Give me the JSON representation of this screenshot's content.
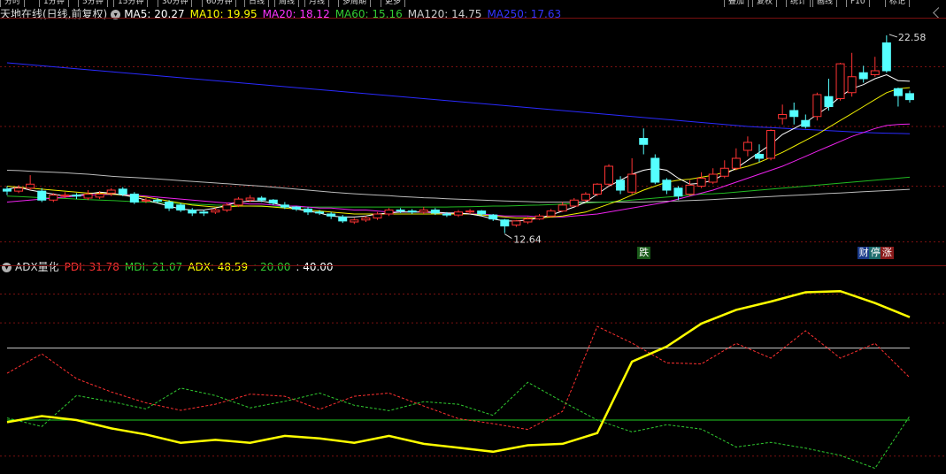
{
  "period_buttons": [
    "分时",
    "1分钟",
    "5分钟",
    "15分钟",
    "30分钟",
    "60分钟",
    "日线",
    "周线",
    "月线",
    "多周期",
    "更多"
  ],
  "right_buttons": [
    "叠加",
    "复权",
    "统计",
    "画线",
    "F10",
    "标记"
  ],
  "main_panel": {
    "title": "天地在线(日线,前复权)",
    "ma_labels": [
      {
        "text": "MA5: 20.27",
        "color": "#ffffff"
      },
      {
        "text": "MA10: 19.95",
        "color": "#ffff00"
      },
      {
        "text": "MA20: 18.12",
        "color": "#ff33ff"
      },
      {
        "text": "MA60: 15.16",
        "color": "#33cc33"
      },
      {
        "text": "MA120: 14.75",
        "color": "#cccccc"
      },
      {
        "text": "MA250: 17.63",
        "color": "#3333ff"
      }
    ],
    "high_label": "22.58",
    "low_label": "12.64",
    "marks": [
      "跌",
      "财",
      "停",
      "涨"
    ]
  },
  "indicator_panel": {
    "name": "ADX量化",
    "labels": [
      {
        "text": "PDI: 31.78",
        "color": "#ff3333"
      },
      {
        "text": "MDI: 21.07",
        "color": "#33cc33"
      },
      {
        "text": "ADX: 48.59",
        "color": "#ffff00"
      },
      {
        "text": ": 20.00",
        "color": "#33cc33"
      },
      {
        "text": ": 40.00",
        "color": "#ffffff"
      }
    ]
  },
  "chart_data": {
    "type": "candlestick",
    "candles": [
      [
        14.85,
        14.75,
        15.0,
        14.55
      ],
      [
        14.75,
        14.9,
        15.05,
        14.65
      ],
      [
        14.9,
        15.1,
        15.55,
        14.8
      ],
      [
        14.75,
        14.3,
        14.9,
        14.2
      ],
      [
        14.3,
        14.55,
        14.65,
        14.2
      ],
      [
        14.5,
        14.55,
        14.7,
        14.4
      ],
      [
        14.55,
        14.5,
        14.65,
        14.35
      ],
      [
        14.4,
        14.6,
        14.8,
        14.3
      ],
      [
        14.45,
        14.6,
        14.75,
        14.35
      ],
      [
        14.65,
        14.8,
        14.9,
        14.5
      ],
      [
        14.85,
        14.6,
        14.95,
        14.5
      ],
      [
        14.6,
        14.2,
        14.7,
        14.1
      ],
      [
        14.25,
        14.3,
        14.4,
        14.15
      ],
      [
        14.3,
        14.25,
        14.4,
        14.15
      ],
      [
        14.2,
        13.9,
        14.3,
        13.75
      ],
      [
        14.05,
        13.8,
        14.15,
        13.7
      ],
      [
        13.8,
        13.65,
        13.9,
        13.5
      ],
      [
        13.7,
        13.65,
        13.8,
        13.5
      ],
      [
        13.7,
        13.8,
        13.9,
        13.6
      ],
      [
        13.8,
        14.05,
        14.15,
        13.7
      ],
      [
        14.05,
        14.35,
        14.45,
        13.95
      ],
      [
        14.3,
        14.4,
        14.55,
        14.2
      ],
      [
        14.4,
        14.3,
        14.5,
        14.2
      ],
      [
        14.3,
        14.15,
        14.35,
        14.05
      ],
      [
        14.05,
        13.95,
        14.2,
        13.85
      ],
      [
        13.95,
        13.85,
        14.0,
        13.75
      ],
      [
        13.85,
        13.7,
        13.95,
        13.55
      ],
      [
        13.7,
        13.65,
        13.8,
        13.55
      ],
      [
        13.6,
        13.5,
        13.7,
        13.35
      ],
      [
        13.45,
        13.25,
        13.55,
        13.15
      ],
      [
        13.2,
        13.3,
        13.4,
        13.1
      ],
      [
        13.3,
        13.4,
        13.5,
        13.2
      ],
      [
        13.4,
        13.6,
        13.7,
        13.3
      ],
      [
        13.6,
        13.8,
        13.9,
        13.5
      ],
      [
        13.8,
        13.75,
        13.9,
        13.65
      ],
      [
        13.75,
        13.7,
        13.85,
        13.6
      ],
      [
        13.7,
        13.8,
        13.95,
        13.6
      ],
      [
        13.8,
        13.65,
        13.9,
        13.55
      ],
      [
        13.6,
        13.55,
        13.7,
        13.45
      ],
      [
        13.55,
        13.7,
        13.8,
        13.45
      ],
      [
        13.7,
        13.75,
        13.85,
        13.6
      ],
      [
        13.75,
        13.6,
        13.8,
        13.5
      ],
      [
        13.55,
        13.35,
        13.6,
        13.25
      ],
      [
        13.3,
        13.0,
        13.35,
        12.64
      ],
      [
        13.05,
        13.25,
        13.3,
        12.95
      ],
      [
        13.2,
        13.35,
        13.45,
        13.1
      ],
      [
        13.35,
        13.5,
        13.6,
        13.3
      ],
      [
        13.5,
        13.75,
        13.85,
        13.45
      ],
      [
        13.75,
        14.05,
        14.2,
        13.7
      ],
      [
        14.0,
        14.3,
        14.4,
        13.95
      ],
      [
        14.3,
        14.6,
        14.7,
        14.2
      ],
      [
        14.6,
        15.1,
        15.15,
        14.5
      ],
      [
        15.1,
        16.0,
        16.1,
        15.0
      ],
      [
        15.3,
        14.8,
        15.5,
        14.6
      ],
      [
        14.7,
        15.6,
        16.4,
        14.6
      ],
      [
        17.4,
        17.1,
        17.9,
        16.6
      ],
      [
        16.4,
        15.2,
        16.6,
        15.1
      ],
      [
        15.3,
        14.8,
        15.4,
        14.6
      ],
      [
        14.9,
        14.5,
        15.0,
        14.3
      ],
      [
        14.6,
        15.05,
        15.3,
        14.5
      ],
      [
        15.0,
        15.4,
        15.7,
        14.9
      ],
      [
        15.2,
        15.6,
        15.9,
        15.1
      ],
      [
        15.5,
        15.9,
        16.3,
        15.4
      ],
      [
        15.9,
        16.4,
        16.9,
        15.8
      ],
      [
        16.8,
        17.2,
        17.5,
        16.5
      ],
      [
        16.6,
        16.4,
        17.1,
        16.2
      ],
      [
        16.4,
        17.8,
        17.85,
        16.3
      ],
      [
        18.4,
        18.6,
        19.1,
        18.1
      ],
      [
        18.8,
        18.5,
        19.2,
        18.1
      ],
      [
        18.3,
        18.0,
        18.6,
        17.9
      ],
      [
        18.5,
        19.6,
        19.7,
        18.3
      ],
      [
        19.5,
        19.0,
        20.4,
        18.8
      ],
      [
        19.4,
        21.15,
        21.2,
        19.3
      ],
      [
        19.7,
        20.5,
        21.7,
        19.5
      ],
      [
        20.7,
        20.4,
        21.05,
        20.2
      ],
      [
        20.6,
        20.8,
        21.5,
        20.5
      ],
      [
        22.2,
        20.8,
        22.58,
        20.7
      ],
      [
        19.9,
        19.55,
        19.95,
        19.0
      ],
      [
        19.65,
        19.35,
        19.8,
        19.2
      ]
    ],
    "ma5": [
      14.85,
      14.95,
      14.8,
      14.7,
      14.6,
      14.5,
      14.55,
      14.6,
      14.7,
      14.65,
      14.55,
      14.45,
      14.3,
      14.15,
      14.0,
      13.85,
      13.8,
      13.8,
      13.9,
      14.05,
      14.2,
      14.25,
      14.25,
      14.15,
      14.0,
      13.85,
      13.75,
      13.65,
      13.5,
      13.45,
      13.45,
      13.5,
      13.6,
      13.65,
      13.7,
      13.7,
      13.7,
      13.7,
      13.65,
      13.65,
      13.6,
      13.5,
      13.35,
      13.25,
      13.25,
      13.3,
      13.4,
      13.55,
      13.75,
      13.95,
      14.2,
      14.6,
      15.0,
      15.3,
      15.6,
      15.8,
      15.9,
      15.8,
      15.4,
      15.1,
      15.15,
      15.3,
      15.6,
      15.9,
      16.3,
      16.7,
      17.1,
      17.6,
      17.9,
      18.2,
      18.6,
      19.0,
      19.5,
      19.9,
      20.1,
      20.4,
      20.6,
      20.3,
      20.27
    ],
    "ma10": [
      15.0,
      14.95,
      14.9,
      14.85,
      14.8,
      14.75,
      14.7,
      14.65,
      14.65,
      14.6,
      14.55,
      14.5,
      14.45,
      14.35,
      14.25,
      14.15,
      14.05,
      14.0,
      13.95,
      13.95,
      14.0,
      14.0,
      14.0,
      13.95,
      13.9,
      13.85,
      13.8,
      13.75,
      13.7,
      13.65,
      13.6,
      13.6,
      13.6,
      13.6,
      13.6,
      13.6,
      13.6,
      13.6,
      13.6,
      13.6,
      13.6,
      13.55,
      13.5,
      13.45,
      13.4,
      13.4,
      13.4,
      13.45,
      13.5,
      13.6,
      13.7,
      13.9,
      14.1,
      14.3,
      14.55,
      14.8,
      15.0,
      15.2,
      15.3,
      15.35,
      15.45,
      15.55,
      15.7,
      15.85,
      16.0,
      16.2,
      16.45,
      16.7,
      17.0,
      17.3,
      17.6,
      17.95,
      18.3,
      18.65,
      19.0,
      19.35,
      19.7,
      19.9,
      19.95
    ],
    "ma20": [
      14.2,
      14.25,
      14.3,
      14.35,
      14.4,
      14.45,
      14.5,
      14.55,
      14.58,
      14.58,
      14.58,
      14.55,
      14.5,
      14.45,
      14.4,
      14.35,
      14.3,
      14.25,
      14.2,
      14.15,
      14.15,
      14.1,
      14.1,
      14.05,
      14.0,
      14.0,
      13.95,
      13.9,
      13.9,
      13.85,
      13.8,
      13.8,
      13.75,
      13.7,
      13.7,
      13.7,
      13.7,
      13.65,
      13.65,
      13.65,
      13.6,
      13.6,
      13.55,
      13.5,
      13.5,
      13.5,
      13.45,
      13.45,
      13.45,
      13.5,
      13.55,
      13.6,
      13.7,
      13.8,
      13.9,
      14.0,
      14.1,
      14.2,
      14.35,
      14.5,
      14.65,
      14.8,
      15.0,
      15.2,
      15.4,
      15.6,
      15.8,
      16.0,
      16.25,
      16.5,
      16.75,
      17.0,
      17.25,
      17.5,
      17.7,
      17.9,
      18.05,
      18.1,
      18.12
    ],
    "ma60": [
      14.5,
      14.48,
      14.45,
      14.42,
      14.4,
      14.38,
      14.35,
      14.32,
      14.3,
      14.28,
      14.25,
      14.22,
      14.2,
      14.18,
      14.15,
      14.12,
      14.1,
      14.08,
      14.05,
      14.03,
      14.0,
      14.0,
      13.98,
      13.97,
      13.96,
      13.95,
      13.95,
      13.95,
      13.95,
      13.95,
      13.95,
      13.95,
      13.95,
      13.95,
      13.95,
      13.95,
      13.95,
      13.95,
      13.95,
      13.96,
      13.97,
      13.98,
      14.0,
      14.0,
      14.02,
      14.04,
      14.05,
      14.07,
      14.1,
      14.12,
      14.15,
      14.18,
      14.2,
      14.25,
      14.3,
      14.35,
      14.4,
      14.45,
      14.5,
      14.55,
      14.6,
      14.62,
      14.65,
      14.7,
      14.75,
      14.8,
      14.85,
      14.9,
      14.95,
      15.0,
      15.05,
      15.1,
      15.15,
      15.2,
      15.25,
      15.3,
      15.35,
      15.4,
      15.45
    ],
    "ma120": [
      15.8,
      15.78,
      15.75,
      15.72,
      15.7,
      15.67,
      15.63,
      15.6,
      15.55,
      15.5,
      15.46,
      15.43,
      15.4,
      15.36,
      15.32,
      15.28,
      15.24,
      15.2,
      15.16,
      15.12,
      15.08,
      15.04,
      15.0,
      14.95,
      14.9,
      14.85,
      14.8,
      14.75,
      14.7,
      14.66,
      14.62,
      14.58,
      14.55,
      14.52,
      14.48,
      14.45,
      14.42,
      14.4,
      14.37,
      14.34,
      14.32,
      14.3,
      14.28,
      14.26,
      14.24,
      14.22,
      14.2,
      14.2,
      14.2,
      14.2,
      14.2,
      14.2,
      14.2,
      14.2,
      14.2,
      14.2,
      14.22,
      14.24,
      14.26,
      14.28,
      14.3,
      14.33,
      14.36,
      14.39,
      14.42,
      14.45,
      14.48,
      14.51,
      14.54,
      14.57,
      14.6,
      14.63,
      14.66,
      14.69,
      14.72,
      14.75,
      14.78,
      14.81,
      14.84
    ],
    "ma250": [
      21.2,
      21.15,
      21.1,
      21.05,
      21.0,
      20.95,
      20.9,
      20.85,
      20.8,
      20.75,
      20.7,
      20.65,
      20.6,
      20.55,
      20.5,
      20.45,
      20.4,
      20.35,
      20.3,
      20.25,
      20.2,
      20.15,
      20.1,
      20.05,
      20.0,
      19.95,
      19.9,
      19.85,
      19.8,
      19.75,
      19.7,
      19.65,
      19.6,
      19.55,
      19.5,
      19.45,
      19.4,
      19.35,
      19.3,
      19.25,
      19.2,
      19.15,
      19.1,
      19.05,
      19.0,
      18.95,
      18.9,
      18.85,
      18.8,
      18.75,
      18.7,
      18.65,
      18.6,
      18.55,
      18.5,
      18.45,
      18.4,
      18.35,
      18.3,
      18.25,
      18.2,
      18.15,
      18.1,
      18.05,
      18.0,
      17.97,
      17.94,
      17.91,
      17.88,
      17.85,
      17.82,
      17.79,
      17.76,
      17.73,
      17.7,
      17.68,
      17.66,
      17.65,
      17.63
    ],
    "adx_x": [
      0,
      4,
      8,
      12,
      16,
      20,
      24,
      28,
      32,
      36,
      40,
      44,
      48,
      52,
      56,
      60,
      64,
      68,
      72,
      76,
      78
    ],
    "adx": [
      19.4,
      21.1,
      20.0,
      17.7,
      16.0,
      13.7,
      14.5,
      13.7,
      15.6,
      14.9,
      13.7,
      15.6,
      13.4,
      12.3,
      11.2,
      13.0,
      13.4,
      16.4,
      36.2,
      40.4,
      46.8,
      50.6,
      52.9,
      55.5,
      55.8,
      52.5,
      48.6
    ],
    "adx_x_full": [
      0,
      3,
      6,
      9,
      12,
      15,
      18,
      21,
      24,
      27,
      30,
      33,
      36,
      39,
      42,
      45,
      48,
      51,
      54,
      57,
      60,
      63,
      66,
      69,
      72,
      75,
      78
    ],
    "pdi": [
      33.0,
      38.4,
      31.5,
      27.8,
      24.8,
      22.7,
      24.4,
      27.2,
      26.6,
      23.0,
      26.6,
      27.5,
      23.9,
      20.4,
      19.0,
      17.4,
      22.4,
      46.0,
      41.4,
      35.9,
      35.6,
      41.3,
      37.2,
      44.8,
      37.2,
      41.3,
      31.8
    ],
    "mdi": [
      20.6,
      18.2,
      26.8,
      25.1,
      23.1,
      28.9,
      26.8,
      23.4,
      25.2,
      27.5,
      24.1,
      22.6,
      25.1,
      24.4,
      21.3,
      30.5,
      25.1,
      20.0,
      16.7,
      18.7,
      17.5,
      12.5,
      13.8,
      12.2,
      10.2,
      6.6,
      21.1
    ],
    "ref_lines": [
      20.0,
      40.0
    ],
    "y_range_main": [
      12.0,
      23.2
    ],
    "y_range_ind": [
      6.0,
      62.0
    ]
  }
}
